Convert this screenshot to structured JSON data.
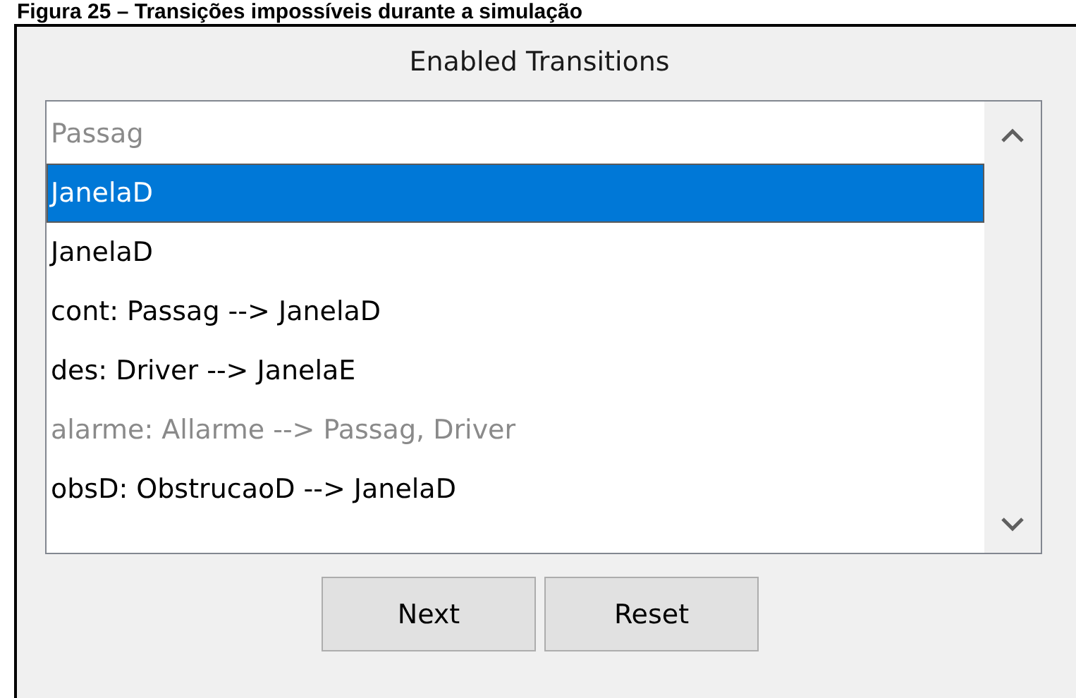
{
  "caption": "Figura 25 – Transições impossíveis durante a simulação",
  "panel": {
    "title": "Enabled Transitions"
  },
  "transitions": [
    {
      "text": "Passag",
      "selected": false,
      "disabled": true
    },
    {
      "text": "JanelaD",
      "selected": true,
      "disabled": false
    },
    {
      "text": "JanelaD",
      "selected": false,
      "disabled": false
    },
    {
      "text": "cont: Passag --> JanelaD",
      "selected": false,
      "disabled": false
    },
    {
      "text": "des: Driver --> JanelaE",
      "selected": false,
      "disabled": false
    },
    {
      "text": "alarme: Allarme --> Passag, Driver",
      "selected": false,
      "disabled": true
    },
    {
      "text": "obsD: ObstrucaoD --> JanelaD",
      "selected": false,
      "disabled": false
    }
  ],
  "buttons": [
    "Next",
    "Reset"
  ]
}
